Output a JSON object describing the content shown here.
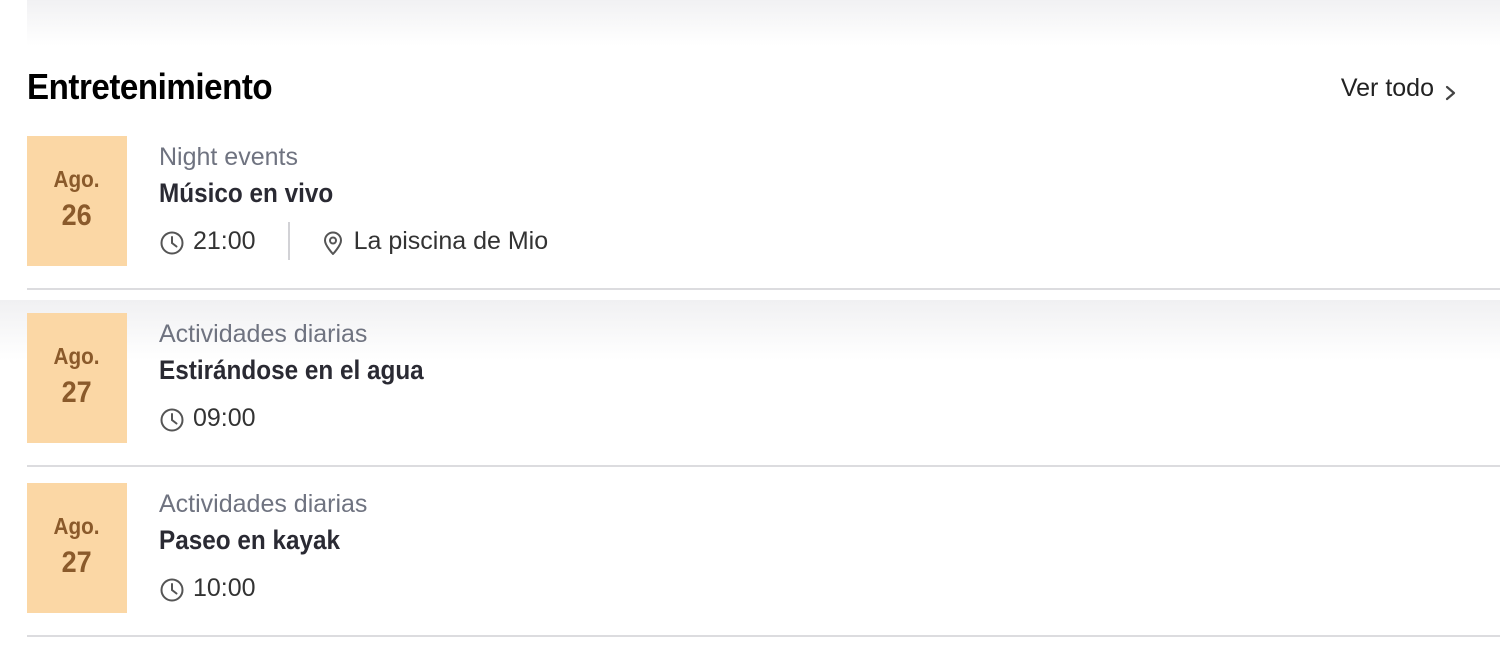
{
  "section": {
    "title": "Entretenimiento",
    "view_all": "Ver todo"
  },
  "events": [
    {
      "month": "Ago.",
      "day": "26",
      "category": "Night events",
      "name": "Músico en vivo",
      "time": "21:00",
      "location": "La piscina de Mio"
    },
    {
      "month": "Ago.",
      "day": "27",
      "category": "Actividades diarias",
      "name": "Estirándose en el agua",
      "time": "09:00"
    },
    {
      "month": "Ago.",
      "day": "27",
      "category": "Actividades diarias",
      "name": "Paseo en kayak",
      "time": "10:00"
    }
  ],
  "colors": {
    "date_bg": "#fbd7a5",
    "date_text": "#8a5a2b",
    "category_text": "#6f7380"
  },
  "icons": [
    "clock-icon",
    "location-pin-icon",
    "chevron-right-icon"
  ]
}
